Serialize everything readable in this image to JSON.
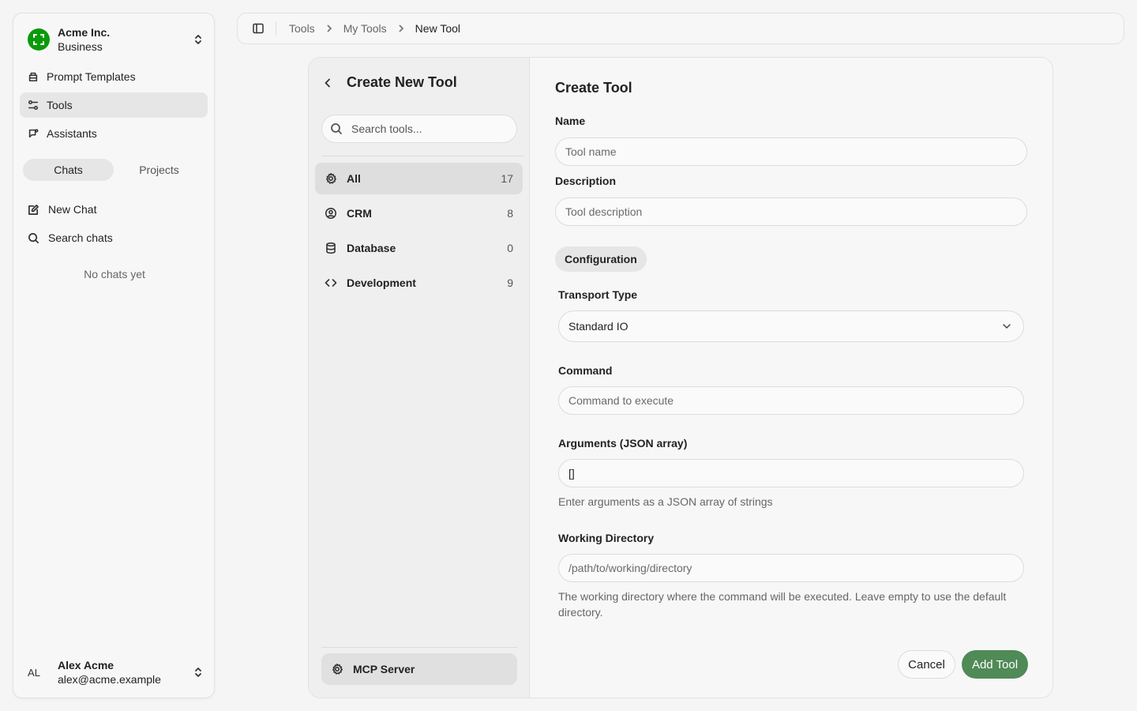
{
  "org": {
    "name": "Acme Inc.",
    "plan": "Business"
  },
  "sidebar": {
    "nav": [
      {
        "label": "Prompt Templates",
        "icon": "template-icon"
      },
      {
        "label": "Tools",
        "icon": "tools-icon",
        "active": true
      },
      {
        "label": "Assistants",
        "icon": "assistant-icon"
      }
    ],
    "tabs": [
      {
        "label": "Chats",
        "active": true
      },
      {
        "label": "Projects"
      }
    ],
    "new_chat": "New Chat",
    "search_chats": "Search chats",
    "empty_text": "No chats yet"
  },
  "user": {
    "initials": "AL",
    "name": "Alex Acme",
    "email": "alex@acme.example"
  },
  "breadcrumb": [
    "Tools",
    "My Tools",
    "New Tool"
  ],
  "tools_panel": {
    "title": "Create New Tool",
    "search_placeholder": "Search tools...",
    "categories": [
      {
        "label": "All",
        "count": "17",
        "icon": "gear-icon",
        "active": true
      },
      {
        "label": "CRM",
        "count": "8",
        "icon": "user-circle-icon"
      },
      {
        "label": "Database",
        "count": "0",
        "icon": "database-icon"
      },
      {
        "label": "Development",
        "count": "9",
        "icon": "code-icon"
      }
    ],
    "mcp_label": "MCP Server"
  },
  "form": {
    "title": "Create Tool",
    "name_label": "Name",
    "name_placeholder": "Tool name",
    "description_label": "Description",
    "description_placeholder": "Tool description",
    "config_label": "Configuration",
    "transport_label": "Transport Type",
    "transport_value": "Standard IO",
    "command_label": "Command",
    "command_placeholder": "Command to execute",
    "arguments_label": "Arguments (JSON array)",
    "arguments_value": "[]",
    "arguments_help": "Enter arguments as a JSON array of strings",
    "workdir_label": "Working Directory",
    "workdir_placeholder": "/path/to/working/directory",
    "workdir_help": "The working directory where the command will be executed. Leave empty to use the default directory.",
    "cancel_label": "Cancel",
    "submit_label": "Add Tool"
  },
  "colors": {
    "accent": "#4f8a57",
    "logo": "#0a9a0a"
  }
}
